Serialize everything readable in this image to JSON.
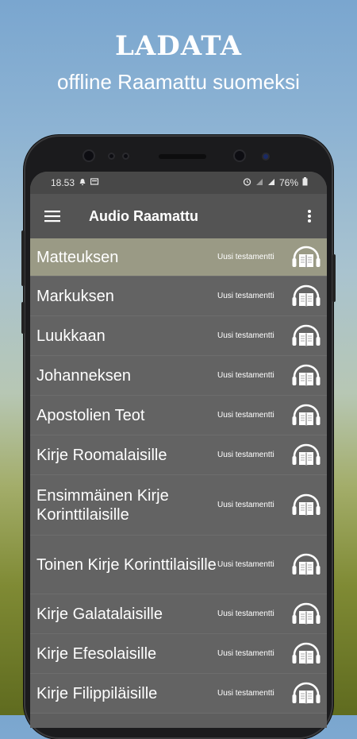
{
  "promo": {
    "title": "LADATA",
    "subtitle": "offline Raamattu suomeksi"
  },
  "status_bar": {
    "time": "18.53",
    "battery": "76%"
  },
  "toolbar": {
    "title": "Audio Raamattu"
  },
  "books": [
    {
      "name": "Matteuksen",
      "testament": "Uusi testamentti",
      "selected": true
    },
    {
      "name": "Markuksen",
      "testament": "Uusi testamentti"
    },
    {
      "name": "Luukkaan",
      "testament": "Uusi testamentti"
    },
    {
      "name": "Johanneksen",
      "testament": "Uusi testamentti"
    },
    {
      "name": "Apostolien Teot",
      "testament": "Uusi testamentti"
    },
    {
      "name": "Kirje Roomalaisille",
      "testament": "Uusi testamentti"
    },
    {
      "name": "Ensimmäinen Kirje Korinttilaisille",
      "testament": "Uusi testamentti"
    },
    {
      "name": "Toinen Kirje Korinttilaisille",
      "testament": "Uusi testamentti"
    },
    {
      "name": "Kirje Galatalaisille",
      "testament": "Uusi testamentti"
    },
    {
      "name": "Kirje Efesolaisille",
      "testament": "Uusi testamentti"
    },
    {
      "name": "Kirje Filippiläisille",
      "testament": "Uusi testamentti"
    }
  ],
  "icons": {
    "menu": "hamburger-menu-icon",
    "more": "more-vertical-icon",
    "row_action": "headphones-book-icon",
    "status": [
      "alarm-icon",
      "notification-icon",
      "wifi-icon",
      "signal-icon",
      "battery-icon"
    ]
  },
  "colors": {
    "selected_row": "#9a9a85",
    "toolbar": "#545454",
    "list_background": "#636363"
  }
}
